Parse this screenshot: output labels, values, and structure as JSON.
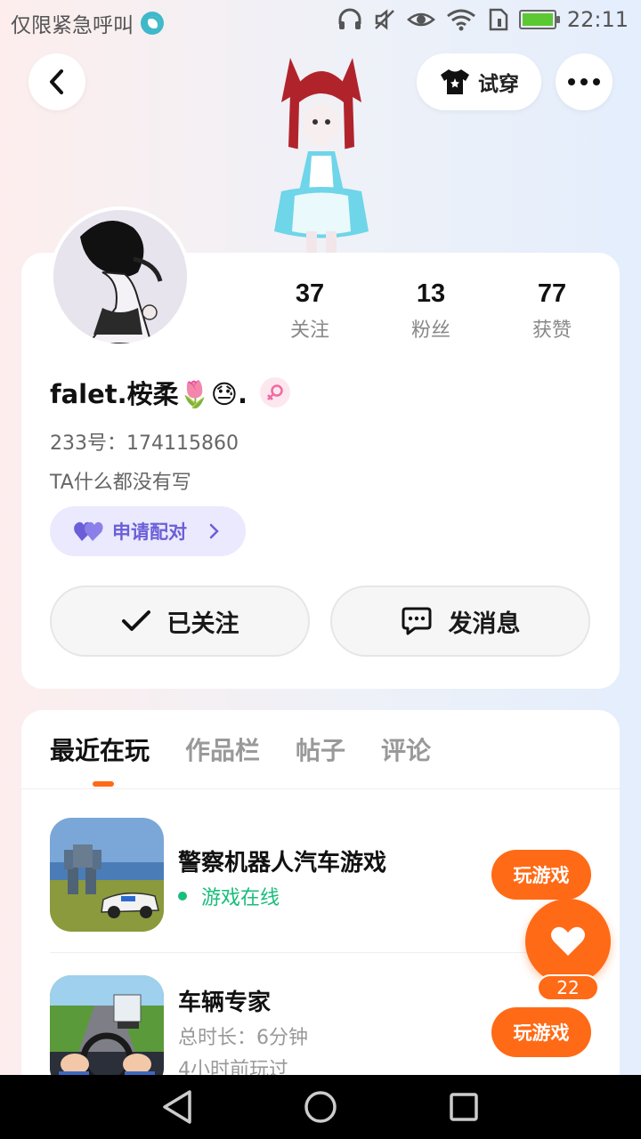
{
  "status_bar": {
    "carrier": "仅限紧急呼叫",
    "time": "22:11"
  },
  "header": {
    "tryon_label": "试穿"
  },
  "profile": {
    "username": "falet.桉柔🌷😓.",
    "uid": "233号：174115860",
    "bio": "TA什么都没有写",
    "stats": [
      {
        "num": "37",
        "label": "关注"
      },
      {
        "num": "13",
        "label": "粉丝"
      },
      {
        "num": "77",
        "label": "获赞"
      }
    ],
    "pair_label": "申请配对",
    "follow_label": "已关注",
    "message_label": "发消息"
  },
  "tabs": [
    "最近在玩",
    "作品栏",
    "帖子",
    "评论"
  ],
  "games": [
    {
      "title": "警察机器人汽车游戏",
      "status": "游戏在线",
      "play_label": "玩游戏"
    },
    {
      "title": "车辆专家",
      "duration": "总时长：6分钟",
      "last_played": "4小时前玩过",
      "play_label": "玩游戏"
    }
  ],
  "like": {
    "count": "22"
  },
  "colors": {
    "accent": "#ff6a16",
    "pair_purple": "#6b5fd8",
    "online_green": "#19be7b"
  }
}
